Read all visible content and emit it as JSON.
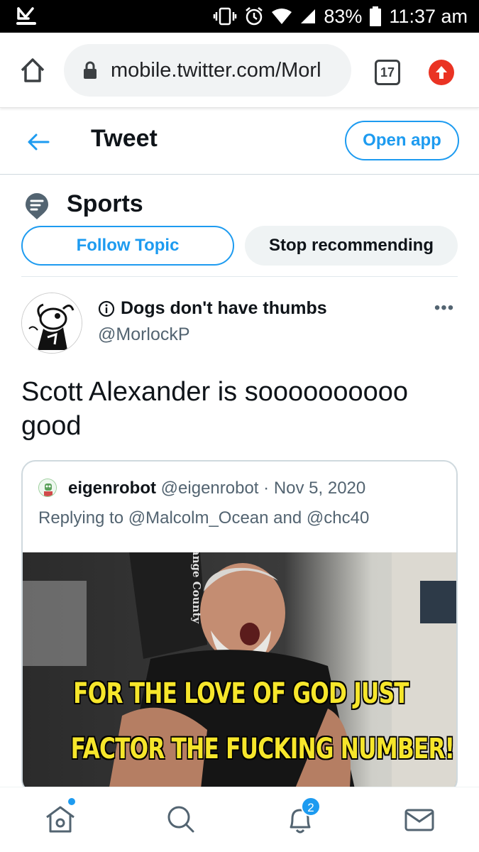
{
  "status_bar": {
    "battery": "83%",
    "time": "11:37 am"
  },
  "browser": {
    "url": "mobile.twitter.com/Morl",
    "tab_count": "17"
  },
  "header": {
    "title": "Tweet",
    "open_app_label": "Open app"
  },
  "topic": {
    "name": "Sports",
    "follow_label": "Follow Topic",
    "stop_label": "Stop recommending"
  },
  "tweet": {
    "author_name": "Dogs don't have thumbs",
    "author_handle": "@MorlockP",
    "more_label": "•••",
    "text": "Scott Alexander is soooooooooo good"
  },
  "quoted_tweet": {
    "name": "eigenrobot",
    "handle": "@eigenrobot",
    "separator": "·",
    "date": "Nov 5, 2020",
    "reply_context": "Replying to @Malcolm_Ocean and @chc40",
    "image_caption_line1": "FOR THE LOVE OF GOD JUST",
    "image_caption_line2": "FACTOR THE FUCKING NUMBER!",
    "image_shirt_text": "Orange County"
  },
  "bottom_nav": {
    "notification_count": "2"
  },
  "colors": {
    "accent": "#1d9bf0",
    "text_primary": "#0f1419",
    "text_secondary": "#536471",
    "meme_text": "#f6e62b"
  }
}
